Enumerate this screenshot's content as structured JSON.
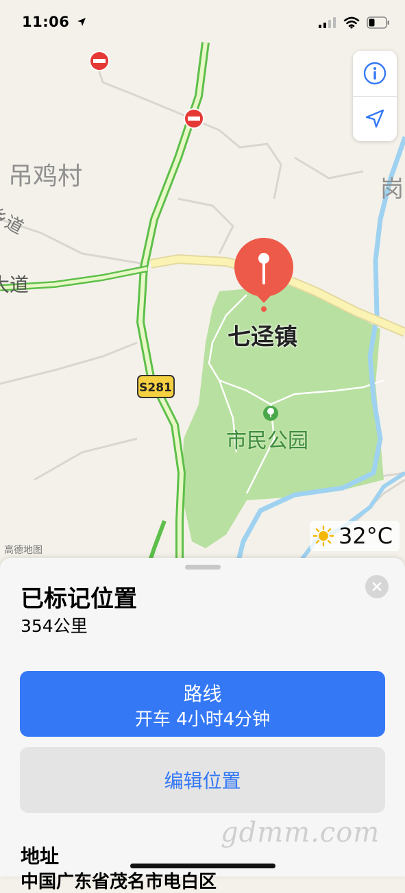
{
  "status_bar": {
    "time": "11:06"
  },
  "map": {
    "labels": {
      "village": "吊鸡村",
      "road_left_1": "乡道",
      "road_left_2": "大道",
      "right_edge": "岗",
      "town": "七迳镇",
      "park": "市民公园",
      "highway_shield": "S281",
      "provider": "高德地图"
    },
    "weather": {
      "temperature": "32°C"
    },
    "controls": {
      "info_icon": "info-icon",
      "location_icon": "location-arrow-icon"
    }
  },
  "colors": {
    "accent_blue": "#3478f6",
    "pin_red": "#ee5a4a",
    "park_green": "#b8e0a0",
    "road_green": "#6fcf5a",
    "road_yellow": "#fbf3b4",
    "water_blue": "#9ed2f0"
  },
  "sheet": {
    "title": "已标记位置",
    "distance": "354公里",
    "route_button": {
      "label": "路线",
      "detail": "开车 4小时4分钟"
    },
    "edit_button": {
      "label": "编辑位置"
    },
    "address": {
      "label": "地址",
      "value": "中国广东省茂名市电白区"
    }
  },
  "watermark": "gdmm.com"
}
